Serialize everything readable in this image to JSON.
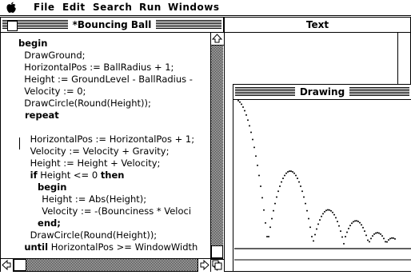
{
  "menubar": {
    "items": [
      "File",
      "Edit",
      "Search",
      "Run",
      "Windows"
    ]
  },
  "editor": {
    "title": "*Bouncing Ball",
    "lines": [
      {
        "text": "begin",
        "bold": true
      },
      {
        "text": "  DrawGround;"
      },
      {
        "text": "  HorizontalPos := BallRadius + 1;"
      },
      {
        "text": "  Height := GroundLevel - BallRadius -"
      },
      {
        "text": "  Velocity := 0;"
      },
      {
        "text": "  DrawCircle(Round(Height));"
      },
      {
        "text": "  repeat",
        "bold": true
      },
      {
        "text": ""
      },
      {
        "text": "    HorizontalPos := HorizontalPos + 1;"
      },
      {
        "text": "    Velocity := Velocity + Gravity;"
      },
      {
        "text": "    Height := Height + Velocity;"
      },
      {
        "text": "    if Height <= 0 then",
        "mixed": true
      },
      {
        "text": "      begin",
        "bold": true
      },
      {
        "text": "        Height := Abs(Height);"
      },
      {
        "text": "        Velocity := -(Bounciness * Veloci"
      },
      {
        "text": "      end;",
        "bold": true
      },
      {
        "text": "    DrawCircle(Round(Height));"
      },
      {
        "text": "  until HorizontalPos >= WindowWidth",
        "mixed": true
      }
    ]
  },
  "text_window": {
    "title": "Text"
  },
  "drawing_window": {
    "title": "Drawing"
  },
  "colors": {
    "foreground": "#000000",
    "background": "#ffffff"
  }
}
